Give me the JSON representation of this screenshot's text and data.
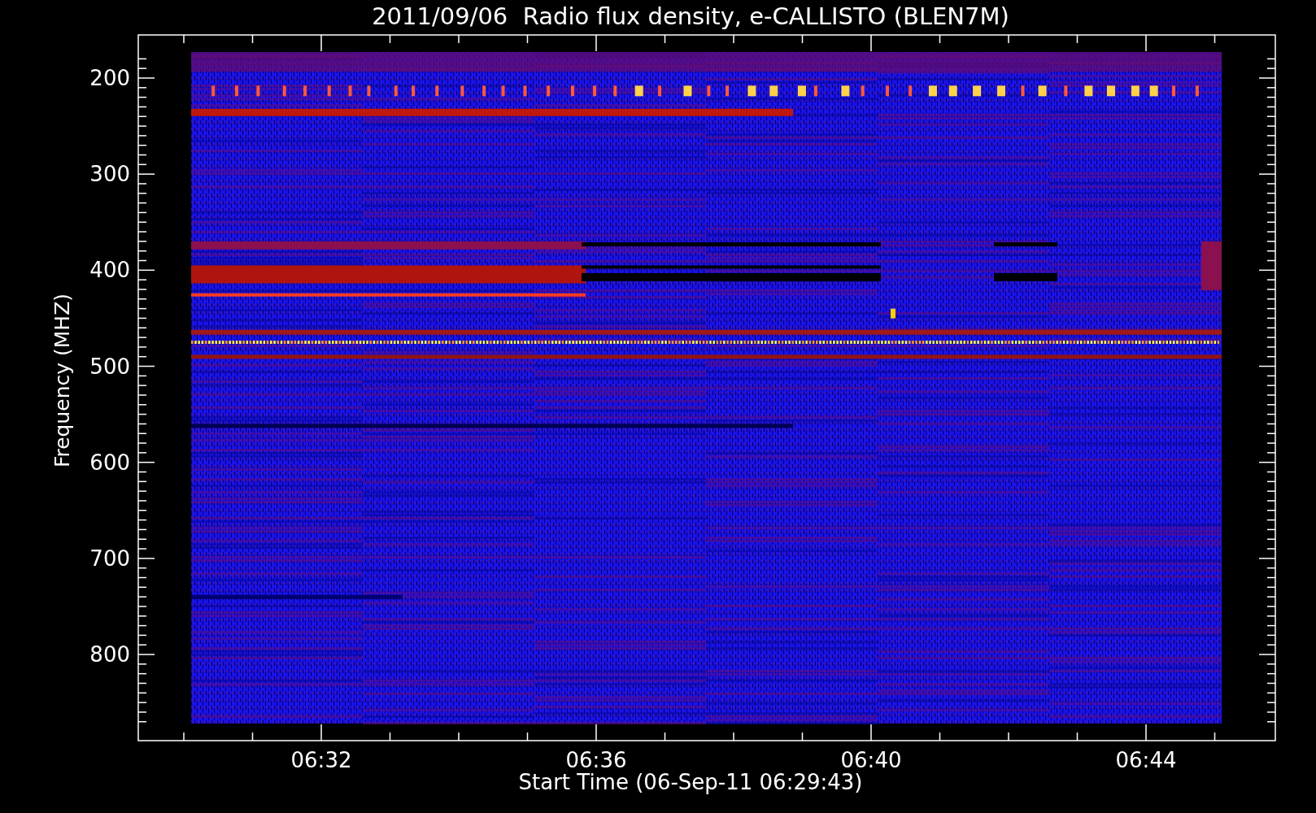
{
  "title": "2011/09/06  Radio flux density, e-CALLISTO (BLEN7M)",
  "y_axis": {
    "label": "Frequency (MHZ)",
    "ticks": [
      "200",
      "300",
      "400",
      "500",
      "600",
      "700",
      "800"
    ]
  },
  "x_axis": {
    "label": "Start Time (06-Sep-11 06:29:43)",
    "ticks": [
      "06:32",
      "06:36",
      "06:40",
      "06:44"
    ]
  }
}
